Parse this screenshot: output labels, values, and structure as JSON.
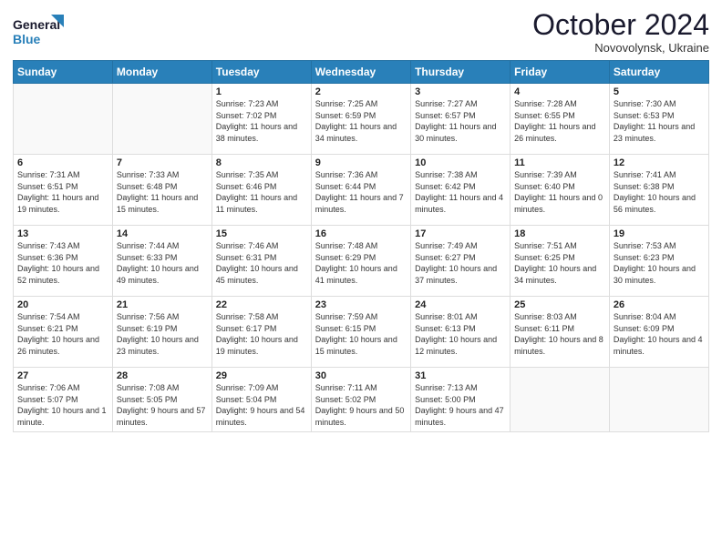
{
  "header": {
    "logo_line1": "General",
    "logo_line2": "Blue",
    "month": "October 2024",
    "location": "Novovolynsk, Ukraine"
  },
  "days_of_week": [
    "Sunday",
    "Monday",
    "Tuesday",
    "Wednesday",
    "Thursday",
    "Friday",
    "Saturday"
  ],
  "weeks": [
    [
      {
        "day": "",
        "info": ""
      },
      {
        "day": "",
        "info": ""
      },
      {
        "day": "1",
        "info": "Sunrise: 7:23 AM\nSunset: 7:02 PM\nDaylight: 11 hours and 38 minutes."
      },
      {
        "day": "2",
        "info": "Sunrise: 7:25 AM\nSunset: 6:59 PM\nDaylight: 11 hours and 34 minutes."
      },
      {
        "day": "3",
        "info": "Sunrise: 7:27 AM\nSunset: 6:57 PM\nDaylight: 11 hours and 30 minutes."
      },
      {
        "day": "4",
        "info": "Sunrise: 7:28 AM\nSunset: 6:55 PM\nDaylight: 11 hours and 26 minutes."
      },
      {
        "day": "5",
        "info": "Sunrise: 7:30 AM\nSunset: 6:53 PM\nDaylight: 11 hours and 23 minutes."
      }
    ],
    [
      {
        "day": "6",
        "info": "Sunrise: 7:31 AM\nSunset: 6:51 PM\nDaylight: 11 hours and 19 minutes."
      },
      {
        "day": "7",
        "info": "Sunrise: 7:33 AM\nSunset: 6:48 PM\nDaylight: 11 hours and 15 minutes."
      },
      {
        "day": "8",
        "info": "Sunrise: 7:35 AM\nSunset: 6:46 PM\nDaylight: 11 hours and 11 minutes."
      },
      {
        "day": "9",
        "info": "Sunrise: 7:36 AM\nSunset: 6:44 PM\nDaylight: 11 hours and 7 minutes."
      },
      {
        "day": "10",
        "info": "Sunrise: 7:38 AM\nSunset: 6:42 PM\nDaylight: 11 hours and 4 minutes."
      },
      {
        "day": "11",
        "info": "Sunrise: 7:39 AM\nSunset: 6:40 PM\nDaylight: 11 hours and 0 minutes."
      },
      {
        "day": "12",
        "info": "Sunrise: 7:41 AM\nSunset: 6:38 PM\nDaylight: 10 hours and 56 minutes."
      }
    ],
    [
      {
        "day": "13",
        "info": "Sunrise: 7:43 AM\nSunset: 6:36 PM\nDaylight: 10 hours and 52 minutes."
      },
      {
        "day": "14",
        "info": "Sunrise: 7:44 AM\nSunset: 6:33 PM\nDaylight: 10 hours and 49 minutes."
      },
      {
        "day": "15",
        "info": "Sunrise: 7:46 AM\nSunset: 6:31 PM\nDaylight: 10 hours and 45 minutes."
      },
      {
        "day": "16",
        "info": "Sunrise: 7:48 AM\nSunset: 6:29 PM\nDaylight: 10 hours and 41 minutes."
      },
      {
        "day": "17",
        "info": "Sunrise: 7:49 AM\nSunset: 6:27 PM\nDaylight: 10 hours and 37 minutes."
      },
      {
        "day": "18",
        "info": "Sunrise: 7:51 AM\nSunset: 6:25 PM\nDaylight: 10 hours and 34 minutes."
      },
      {
        "day": "19",
        "info": "Sunrise: 7:53 AM\nSunset: 6:23 PM\nDaylight: 10 hours and 30 minutes."
      }
    ],
    [
      {
        "day": "20",
        "info": "Sunrise: 7:54 AM\nSunset: 6:21 PM\nDaylight: 10 hours and 26 minutes."
      },
      {
        "day": "21",
        "info": "Sunrise: 7:56 AM\nSunset: 6:19 PM\nDaylight: 10 hours and 23 minutes."
      },
      {
        "day": "22",
        "info": "Sunrise: 7:58 AM\nSunset: 6:17 PM\nDaylight: 10 hours and 19 minutes."
      },
      {
        "day": "23",
        "info": "Sunrise: 7:59 AM\nSunset: 6:15 PM\nDaylight: 10 hours and 15 minutes."
      },
      {
        "day": "24",
        "info": "Sunrise: 8:01 AM\nSunset: 6:13 PM\nDaylight: 10 hours and 12 minutes."
      },
      {
        "day": "25",
        "info": "Sunrise: 8:03 AM\nSunset: 6:11 PM\nDaylight: 10 hours and 8 minutes."
      },
      {
        "day": "26",
        "info": "Sunrise: 8:04 AM\nSunset: 6:09 PM\nDaylight: 10 hours and 4 minutes."
      }
    ],
    [
      {
        "day": "27",
        "info": "Sunrise: 7:06 AM\nSunset: 5:07 PM\nDaylight: 10 hours and 1 minute."
      },
      {
        "day": "28",
        "info": "Sunrise: 7:08 AM\nSunset: 5:05 PM\nDaylight: 9 hours and 57 minutes."
      },
      {
        "day": "29",
        "info": "Sunrise: 7:09 AM\nSunset: 5:04 PM\nDaylight: 9 hours and 54 minutes."
      },
      {
        "day": "30",
        "info": "Sunrise: 7:11 AM\nSunset: 5:02 PM\nDaylight: 9 hours and 50 minutes."
      },
      {
        "day": "31",
        "info": "Sunrise: 7:13 AM\nSunset: 5:00 PM\nDaylight: 9 hours and 47 minutes."
      },
      {
        "day": "",
        "info": ""
      },
      {
        "day": "",
        "info": ""
      }
    ]
  ]
}
